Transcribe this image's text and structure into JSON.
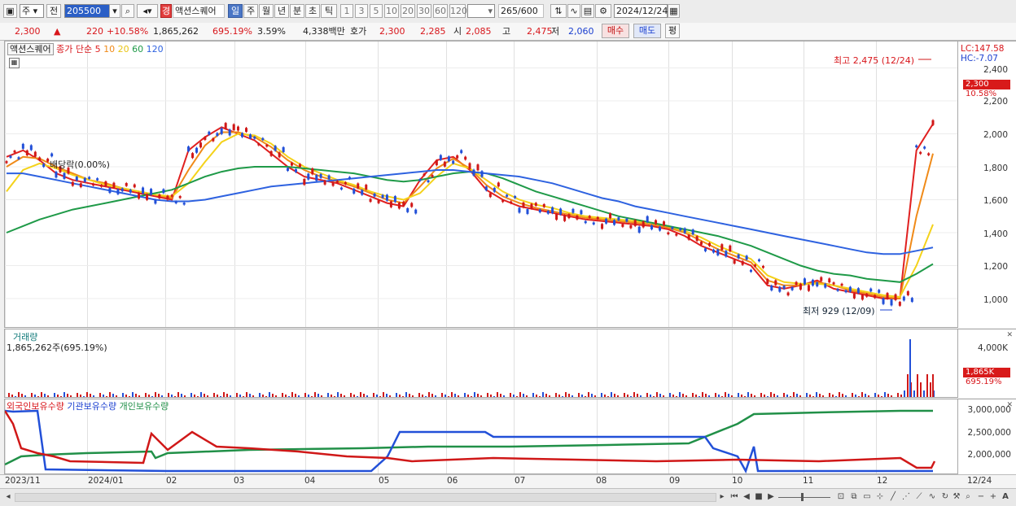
{
  "toolbar": {
    "period_type": "주",
    "prev_label": "전",
    "code": "205500",
    "stock_badge": "경",
    "stock_name": "액션스퀘어",
    "periods": [
      "일",
      "주",
      "월",
      "년",
      "분",
      "초",
      "틱"
    ],
    "selected_period": "일",
    "intervals": [
      "1",
      "3",
      "5",
      "10",
      "20",
      "30",
      "60",
      "120"
    ],
    "count": "265",
    "count_total": "/600",
    "date": "2024/12/24"
  },
  "quote": {
    "price": "2,300",
    "change_sign": "▲",
    "change": "220",
    "change_pct": "+10.58%",
    "volume": "1,865,262",
    "volume_ratio": "695.19%",
    "turnover": "3.59%",
    "amount": "4,338백만",
    "bid_label": "호가",
    "ask": "2,300",
    "bid": "2,285",
    "open_label": "시",
    "open": "2,085",
    "high_label": "고",
    "high": "2,475",
    "low_label": "저",
    "low": "2,060",
    "buy_label": "매수",
    "sell_label": "매도",
    "flat_label": "평"
  },
  "price_panel": {
    "legend_name": "액션스퀘어",
    "ma_legend": "종가 단순",
    "ma_periods": [
      "5",
      "10",
      "20",
      "60",
      "120"
    ],
    "ma_colors": [
      "#e02020",
      "#f08a18",
      "#f4d21a",
      "#1f9a48",
      "#2e62e0"
    ],
    "lc": "LC:147.58",
    "hc": "HC:-7.07",
    "y_ticks": [
      "2,400",
      "2,200",
      "2,000",
      "1,800",
      "1,600",
      "1,400",
      "1,200",
      "1,000"
    ],
    "price_tag": "2,300",
    "pct_tag": "10.58%",
    "high_annotation": "최고 2,475 (12/24)",
    "low_annotation": "최저 929 (12/09)",
    "dividend_annotation": "배당락(0.00%)"
  },
  "volume_panel": {
    "title": "거래량",
    "value": "1,865,262주(695.19%)",
    "y_ticks": [
      "4,000K"
    ],
    "vol_tag": "1,865K",
    "vol_pct_tag": "695.19%"
  },
  "holdings_panel": {
    "legends": [
      "외국인보유수량",
      "기관보유수량",
      "개인보유수량"
    ],
    "legend_colors": [
      "#d01818",
      "#2250d8",
      "#219048"
    ],
    "y_ticks": [
      "3,000,000",
      "2,500,000",
      "2,000,000"
    ]
  },
  "date_axis": {
    "labels": [
      "2023/11",
      "2024/01",
      "02",
      "03",
      "04",
      "05",
      "06",
      "07",
      "08",
      "09",
      "10",
      "11",
      "12"
    ],
    "right_label": "12/24"
  },
  "chart_data": {
    "type": "line",
    "title": "",
    "y_range": [
      900,
      2500
    ],
    "ma_series": [
      {
        "name": "5",
        "values": [
          1860,
          1900,
          1840,
          1760,
          1720,
          1700,
          1680,
          1660,
          1640,
          1620,
          1600,
          1900,
          1980,
          2040,
          2000,
          1960,
          1880,
          1800,
          1740,
          1720,
          1700,
          1660,
          1620,
          1580,
          1560,
          1720,
          1840,
          1860,
          1780,
          1660,
          1600,
          1560,
          1540,
          1520,
          1500,
          1480,
          1470,
          1460,
          1450,
          1440,
          1420,
          1380,
          1320,
          1280,
          1240,
          1200,
          1080,
          1060,
          1080,
          1110,
          1060,
          1040,
          1020,
          1000,
          1000,
          1900,
          2060
        ]
      },
      {
        "name": "10",
        "values": [
          1800,
          1860,
          1850,
          1800,
          1760,
          1720,
          1700,
          1670,
          1650,
          1630,
          1610,
          1780,
          1930,
          2010,
          2010,
          1980,
          1920,
          1840,
          1780,
          1740,
          1710,
          1680,
          1640,
          1600,
          1580,
          1680,
          1790,
          1850,
          1790,
          1690,
          1620,
          1580,
          1550,
          1530,
          1510,
          1490,
          1480,
          1470,
          1460,
          1450,
          1430,
          1400,
          1350,
          1300,
          1260,
          1220,
          1110,
          1080,
          1080,
          1100,
          1080,
          1050,
          1030,
          1010,
          1000,
          1500,
          1880
        ]
      },
      {
        "name": "20",
        "values": [
          1650,
          1780,
          1820,
          1790,
          1750,
          1720,
          1690,
          1670,
          1650,
          1630,
          1620,
          1700,
          1830,
          1950,
          2000,
          1990,
          1940,
          1860,
          1800,
          1760,
          1720,
          1690,
          1650,
          1620,
          1600,
          1640,
          1740,
          1820,
          1790,
          1720,
          1650,
          1600,
          1570,
          1550,
          1520,
          1500,
          1490,
          1480,
          1470,
          1460,
          1440,
          1410,
          1370,
          1320,
          1280,
          1240,
          1140,
          1100,
          1090,
          1090,
          1080,
          1060,
          1040,
          1020,
          1010,
          1200,
          1450
        ]
      },
      {
        "name": "60",
        "values": [
          1400,
          1440,
          1480,
          1510,
          1540,
          1560,
          1580,
          1600,
          1620,
          1640,
          1660,
          1700,
          1740,
          1770,
          1790,
          1800,
          1800,
          1800,
          1790,
          1780,
          1770,
          1760,
          1740,
          1720,
          1710,
          1720,
          1740,
          1760,
          1770,
          1760,
          1730,
          1690,
          1650,
          1620,
          1590,
          1560,
          1530,
          1500,
          1480,
          1460,
          1440,
          1420,
          1400,
          1380,
          1350,
          1320,
          1280,
          1240,
          1200,
          1170,
          1150,
          1140,
          1120,
          1110,
          1100,
          1150,
          1210
        ]
      },
      {
        "name": "120",
        "values": [
          1760,
          1760,
          1740,
          1720,
          1700,
          1680,
          1660,
          1640,
          1620,
          1600,
          1590,
          1590,
          1600,
          1620,
          1640,
          1660,
          1680,
          1690,
          1700,
          1710,
          1720,
          1730,
          1740,
          1750,
          1760,
          1770,
          1780,
          1780,
          1770,
          1760,
          1750,
          1740,
          1720,
          1700,
          1670,
          1640,
          1610,
          1590,
          1560,
          1540,
          1520,
          1500,
          1480,
          1460,
          1440,
          1420,
          1400,
          1380,
          1360,
          1340,
          1320,
          1300,
          1280,
          1270,
          1270,
          1290,
          1310
        ]
      }
    ]
  }
}
